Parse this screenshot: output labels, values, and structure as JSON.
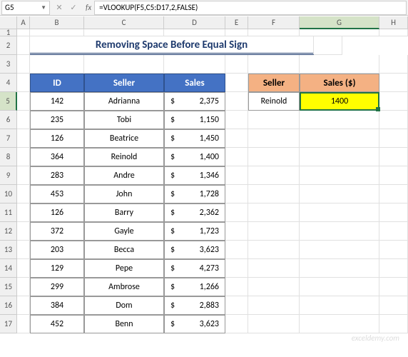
{
  "name_box": "G5",
  "formula": "=VLOOKUP(F5,C5:D17,2,FALSE)",
  "fx_label": "fx",
  "columns": [
    "A",
    "B",
    "C",
    "D",
    "E",
    "F",
    "G",
    "H"
  ],
  "active_col": "G",
  "active_row": "5",
  "title": "Removing Space Before Equal Sign",
  "headers": {
    "id": "ID",
    "seller": "Seller",
    "sales": "Sales"
  },
  "lookup_headers": {
    "seller": "Seller",
    "sales": "Sales ($)"
  },
  "lookup": {
    "seller": "Reinold",
    "result": "1400"
  },
  "currency": "$",
  "rows": [
    {
      "n": "1"
    },
    {
      "n": "2",
      "title": true
    },
    {
      "n": "3"
    },
    {
      "n": "4",
      "header": true
    },
    {
      "n": "5",
      "id": "142",
      "seller": "Adrianna",
      "sales": "2,375",
      "lookup": true
    },
    {
      "n": "6",
      "id": "235",
      "seller": "Tobi",
      "sales": "1,150"
    },
    {
      "n": "7",
      "id": "126",
      "seller": "Beatrice",
      "sales": "1,450"
    },
    {
      "n": "8",
      "id": "364",
      "seller": "Reinold",
      "sales": "1,400"
    },
    {
      "n": "9",
      "id": "283",
      "seller": "Andre",
      "sales": "1,346"
    },
    {
      "n": "10",
      "id": "453",
      "seller": "John",
      "sales": "1,728"
    },
    {
      "n": "11",
      "id": "126",
      "seller": "Barry",
      "sales": "2,362"
    },
    {
      "n": "12",
      "id": "372",
      "seller": "Gayle",
      "sales": "1,723"
    },
    {
      "n": "13",
      "id": "203",
      "seller": "Becca",
      "sales": "3,623"
    },
    {
      "n": "14",
      "id": "129",
      "seller": "Pepe",
      "sales": "4,273"
    },
    {
      "n": "15",
      "id": "299",
      "seller": "Ambrose",
      "sales": "1,266"
    },
    {
      "n": "16",
      "id": "384",
      "seller": "Dom",
      "sales": "2,883"
    },
    {
      "n": "17",
      "id": "452",
      "seller": "Benn",
      "sales": "3,623"
    }
  ],
  "watermark": "exceldemy.com"
}
